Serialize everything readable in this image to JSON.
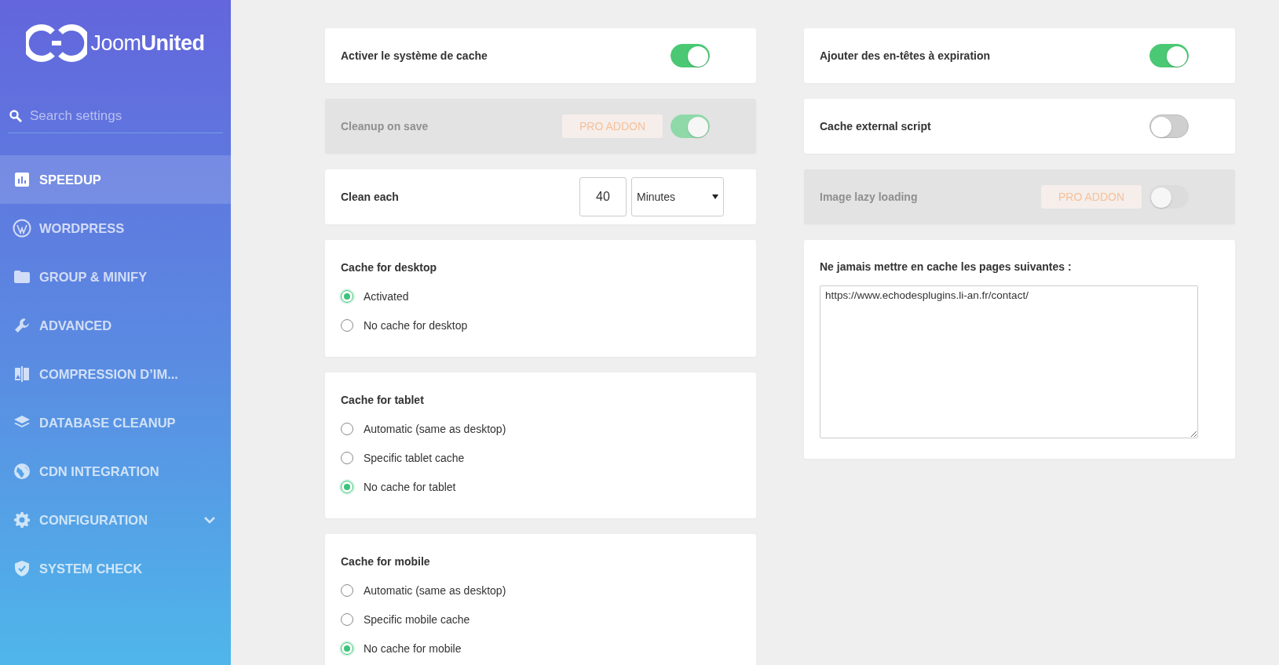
{
  "sidebar": {
    "logo": "Joom**United**",
    "search": {
      "placeholder": "Search settings"
    },
    "items": [
      {
        "label": "SPEEDUP",
        "selected": true,
        "kind": "link"
      },
      {
        "label": "WORDPRESS",
        "selected": false,
        "kind": "link"
      },
      {
        "label": "GROUP & MINIFY",
        "selected": false,
        "kind": "link"
      },
      {
        "label": "ADVANCED",
        "selected": false,
        "kind": "link"
      },
      {
        "label": "COMPRESSION D’IM...",
        "selected": false,
        "kind": "link"
      },
      {
        "label": "DATABASE CLEANUP",
        "selected": false,
        "kind": "link"
      },
      {
        "label": "CDN INTEGRATION",
        "selected": false,
        "kind": "link"
      },
      {
        "label": "CONFIGURATION",
        "selected": false,
        "kind": "group",
        "expanded": false
      },
      {
        "label": "SYSTEM CHECK",
        "selected": false,
        "kind": "link"
      }
    ]
  },
  "left_column": [
    {
      "kind": "toggle",
      "label": "Activer le système de cache",
      "on": true,
      "disabled": false
    },
    {
      "kind": "toggle",
      "label": "Cleanup on save",
      "on": true,
      "disabled": true,
      "badge": "PRO ADDON"
    },
    {
      "kind": "interval",
      "label": "Clean each",
      "value": "40",
      "unit": "Minutes"
    },
    {
      "kind": "radio_group",
      "label": "Cache for desktop",
      "options": [
        {
          "label": "Activated",
          "selected": true
        },
        {
          "label": "No cache for desktop",
          "selected": false
        }
      ]
    },
    {
      "kind": "radio_group",
      "label": "Cache for tablet",
      "options": [
        {
          "label": "Automatic (same as desktop)",
          "selected": false
        },
        {
          "label": "Specific tablet cache",
          "selected": false
        },
        {
          "label": "No cache for tablet",
          "selected": true
        }
      ]
    },
    {
      "kind": "radio_group",
      "label": "Cache for mobile",
      "options": [
        {
          "label": "Automatic (same as desktop)",
          "selected": false
        },
        {
          "label": "Specific mobile cache",
          "selected": false
        },
        {
          "label": "No cache for mobile",
          "selected": true
        }
      ]
    }
  ],
  "right_column": [
    {
      "kind": "toggle",
      "label": "Ajouter des en-têtes à expiration",
      "on": true,
      "disabled": false
    },
    {
      "kind": "toggle",
      "label": "Cache external script",
      "on": false,
      "disabled": false
    },
    {
      "kind": "toggle",
      "label": "Image lazy loading",
      "on": false,
      "disabled": true,
      "badge": "PRO ADDON"
    },
    {
      "kind": "textarea",
      "label": "Ne jamais mettre en cache les pages suivantes :",
      "value": "https://www.echodesplugins.li-an.fr/contact/"
    }
  ]
}
